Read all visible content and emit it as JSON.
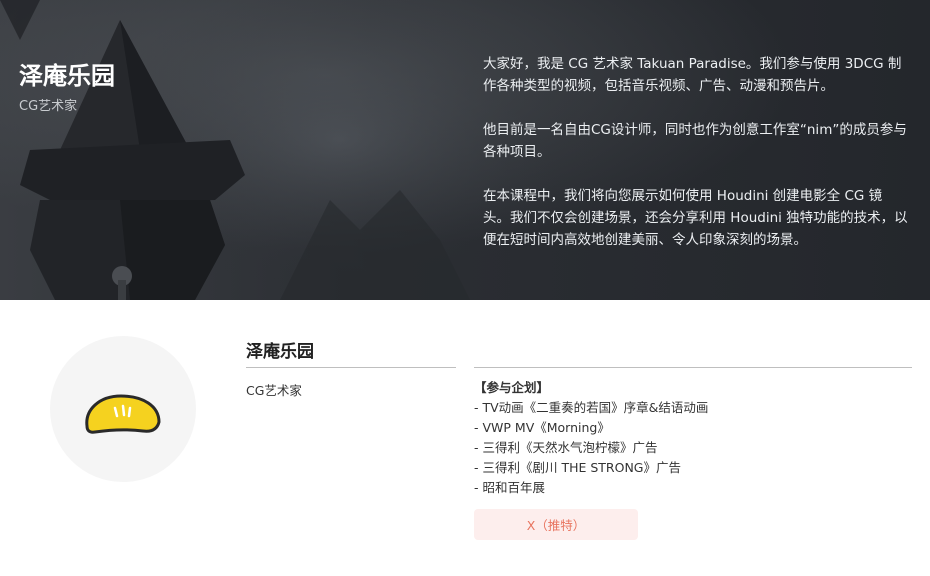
{
  "hero": {
    "title": "泽庵乐园",
    "subtitle": "CG艺术家",
    "paragraphs": [
      "大家好，我是 CG 艺术家 Takuan Paradise。我们参与使用 3DCG 制作各种类型的视频，包括音乐视频、广告、动漫和预告片。",
      "他目前是一名自由CG设计师，同时也作为创意工作室“nim”的成员参与各种项目。",
      "在本课程中，我们将向您展示如何使用 Houdini 创建电影全 CG 镜头。我们不仅会创建场景，还会分享利用 Houdini 独特功能的技术，以便在短时间内高效地创建美丽、令人印象深刻的场景。"
    ]
  },
  "profile": {
    "name": "泽庵乐园",
    "role": "CG艺术家",
    "avatar_icon": "yellow-bun-icon",
    "projects_heading": "【参与企划】",
    "projects": [
      "- TV动画《二重奏的若国》序章&结语动画",
      "- VWP MV《Morning》",
      "- 三得利《天然水气泡柠檬》广告",
      "- 三得利《剧川 THE STRONG》广告",
      "- 昭和百年展"
    ],
    "x_button_label": "X（推特）"
  },
  "colors": {
    "hero_bg": "#2b2e33",
    "button_bg": "#fdeeed",
    "button_text": "#e8745f",
    "avatar_bg": "#f5f5f5",
    "avatar_fill": "#f5d21f"
  }
}
